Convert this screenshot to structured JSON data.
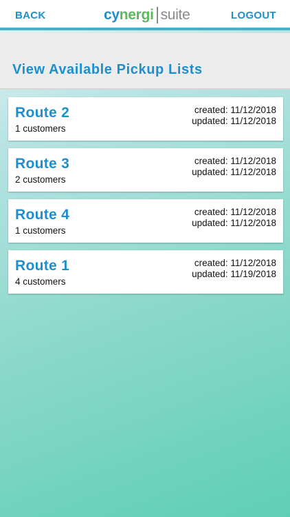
{
  "header": {
    "back_label": "BACK",
    "logout_label": "LOGOUT",
    "logo": {
      "part1": "cy",
      "part2": "nergi",
      "part3": "suite"
    }
  },
  "page_title": "View Available Pickup Lists",
  "routes": [
    {
      "name": "Route 2",
      "customers": "1 customers",
      "created": "created: 11/12/2018",
      "updated": "updated: 11/12/2018"
    },
    {
      "name": "Route 3",
      "customers": "2 customers",
      "created": "created: 11/12/2018",
      "updated": "updated: 11/12/2018"
    },
    {
      "name": "Route 4",
      "customers": "1 customers",
      "created": "created: 11/12/2018",
      "updated": "updated: 11/12/2018"
    },
    {
      "name": "Route 1",
      "customers": "4 customers",
      "created": "created: 11/12/2018",
      "updated": "updated: 11/19/2018"
    }
  ],
  "colors": {
    "accent": "#1d8fcc",
    "logo_green": "#5cb85c",
    "header_rule": "#4ab0c8"
  }
}
